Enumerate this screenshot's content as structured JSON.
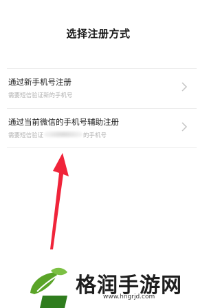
{
  "page": {
    "title": "选择注册方式"
  },
  "options": [
    {
      "title": "通过新手机号注册",
      "subtitle": "需要短信验证新的手机号"
    },
    {
      "title": "通过当前微信的手机号辅助注册",
      "subtitle_prefix": "需要短信验证",
      "subtitle_suffix": "的手机号"
    }
  ],
  "watermark": {
    "name": "格润手游网",
    "url": "www.hngrjd.com"
  },
  "colors": {
    "arrow": "#f0243a",
    "logo_green": "#5aa428",
    "logo_dark_green": "#2f7d1e"
  }
}
